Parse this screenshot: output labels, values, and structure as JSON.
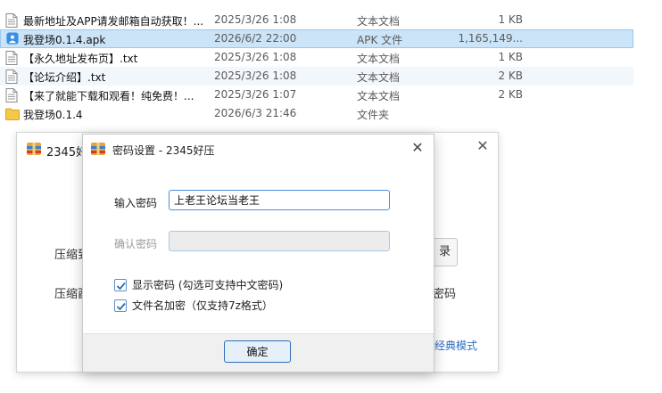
{
  "file_list": {
    "rows": [
      {
        "name": "最新地址及APP请发邮箱自动获取！...",
        "date": "2025/3/26 1:08",
        "type": "文本文档",
        "size": "1 KB",
        "icon": "text-file-icon"
      },
      {
        "name": "我登场0.1.4.apk",
        "date": "2026/6/2 22:00",
        "type": "APK 文件",
        "size": "1,165,149...",
        "icon": "apk-file-icon"
      },
      {
        "name": "【永久地址发布页】.txt",
        "date": "2025/3/26 1:08",
        "type": "文本文档",
        "size": "1 KB",
        "icon": "text-file-icon"
      },
      {
        "name": "【论坛介绍】.txt",
        "date": "2025/3/26 1:08",
        "type": "文本文档",
        "size": "2 KB",
        "icon": "text-file-icon"
      },
      {
        "name": "【来了就能下载和观看！纯免费！...",
        "date": "2025/3/26 1:07",
        "type": "文本文档",
        "size": "2 KB",
        "icon": "text-file-icon"
      },
      {
        "name": "我登场0.1.4",
        "date": "2026/6/3 21:46",
        "type": "文件夹",
        "size": "",
        "icon": "folder-icon"
      }
    ]
  },
  "background_window": {
    "title": "2345好",
    "label_compress_to": "压缩到",
    "label_compress_format": "压缩酉",
    "button_fragment": "录",
    "right_fragment": "密码",
    "link_fragment": "经典模式"
  },
  "dialog": {
    "title": "密码设置 - 2345好压",
    "password_label": "输入密码",
    "password_value": "上老王论坛当老王",
    "confirm_label": "确认密码",
    "confirm_value": "",
    "show_password_label": "显示密码 (勾选可支持中文密码)",
    "show_password_checked": true,
    "encrypt_filenames_label": "文件名加密（仅支持7z格式）",
    "encrypt_filenames_checked": true,
    "ok_label": "确定"
  },
  "colors": {
    "selection_bg": "#cce4f7",
    "accent_border": "#4a8fd6",
    "checkmark": "#2e6fb3"
  }
}
